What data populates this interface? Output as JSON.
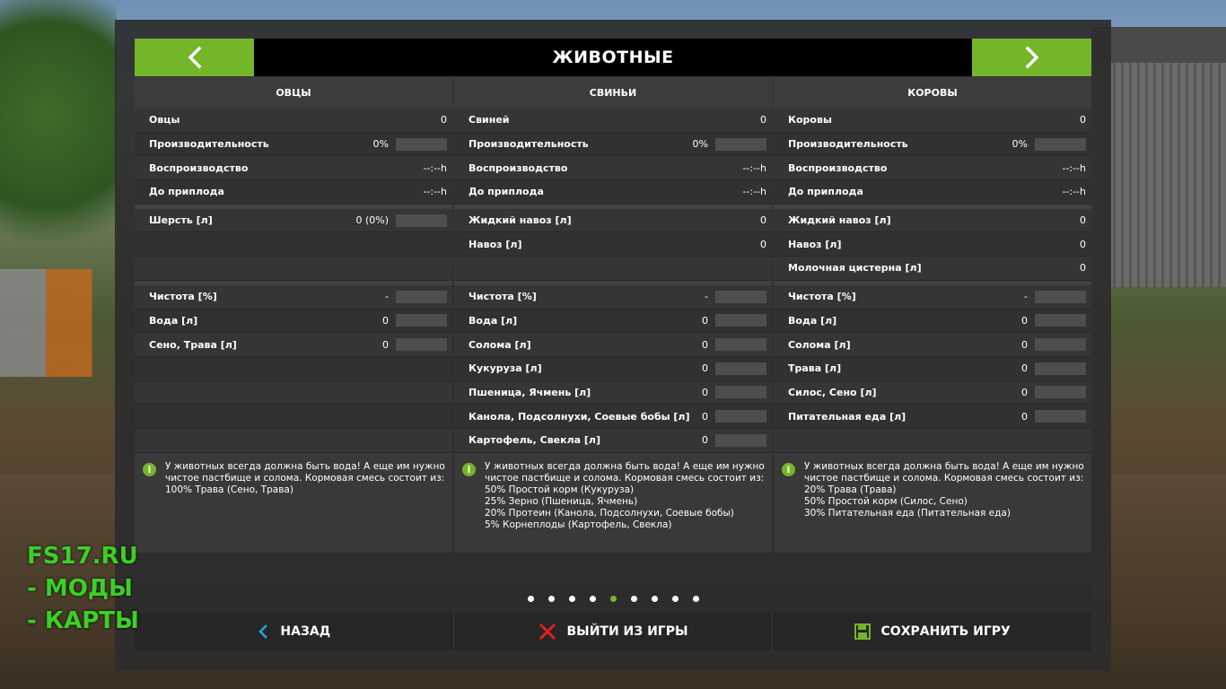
{
  "header": {
    "title": "ЖИВОТНЫЕ"
  },
  "columns": [
    {
      "title": "ОВЦЫ",
      "stats": [
        {
          "label": "Овцы",
          "value": "0",
          "bar": false
        },
        {
          "label": "Производительность",
          "value": "0%",
          "bar": true
        },
        {
          "label": "Воспроизводство",
          "value": "--:--h",
          "bar": false
        },
        {
          "label": "До приплода",
          "value": "--:--h",
          "bar": false
        }
      ],
      "products": [
        {
          "label": "Шерсть [л]",
          "value": "0 (0%)",
          "bar": true
        },
        {
          "label": "",
          "value": "",
          "bar": false
        },
        {
          "label": "",
          "value": "",
          "bar": false
        }
      ],
      "needs": [
        {
          "label": "Чистота [%]",
          "value": "-",
          "bar": true
        },
        {
          "label": "Вода [л]",
          "value": "0",
          "bar": true
        },
        {
          "label": "Сено, Трава [л]",
          "value": "0",
          "bar": true
        },
        {
          "label": "",
          "value": "",
          "bar": false
        },
        {
          "label": "",
          "value": "",
          "bar": false
        },
        {
          "label": "",
          "value": "",
          "bar": false
        },
        {
          "label": "",
          "value": "",
          "bar": false
        }
      ],
      "info": "У животных всегда должна быть вода! А еще им нужно чистое пастбище и солома. Кормовая смесь состоит из:\n100% Трава (Сено, Трава)"
    },
    {
      "title": "СВИНЬИ",
      "stats": [
        {
          "label": "Свиней",
          "value": "0",
          "bar": false
        },
        {
          "label": "Производительность",
          "value": "0%",
          "bar": true
        },
        {
          "label": "Воспроизводство",
          "value": "--:--h",
          "bar": false
        },
        {
          "label": "До приплода",
          "value": "--:--h",
          "bar": false
        }
      ],
      "products": [
        {
          "label": "Жидкий навоз [л]",
          "value": "0",
          "bar": false
        },
        {
          "label": "Навоз [л]",
          "value": "0",
          "bar": false
        },
        {
          "label": "",
          "value": "",
          "bar": false
        }
      ],
      "needs": [
        {
          "label": "Чистота [%]",
          "value": "-",
          "bar": true
        },
        {
          "label": "Вода [л]",
          "value": "0",
          "bar": true
        },
        {
          "label": "Солома [л]",
          "value": "0",
          "bar": true
        },
        {
          "label": "Кукуруза [л]",
          "value": "0",
          "bar": true
        },
        {
          "label": "Пшеница, Ячмень [л]",
          "value": "0",
          "bar": true
        },
        {
          "label": "Канола, Подсолнухи, Соевые бобы [л]",
          "value": "0",
          "bar": true
        },
        {
          "label": "Картофель, Свекла [л]",
          "value": "0",
          "bar": true
        }
      ],
      "info": "У животных всегда должна быть вода! А еще им нужно чистое пастбище и солома. Кормовая смесь состоит из:\n50% Простой корм (Кукуруза)\n25% Зерно (Пшеница, Ячмень)\n20% Протеин (Канола, Подсолнухи, Соевые бобы)\n5% Корнеплоды (Картофель, Свекла)"
    },
    {
      "title": "КОРОВЫ",
      "stats": [
        {
          "label": "Коровы",
          "value": "0",
          "bar": false
        },
        {
          "label": "Производительность",
          "value": "0%",
          "bar": true
        },
        {
          "label": "Воспроизводство",
          "value": "--:--h",
          "bar": false
        },
        {
          "label": "До приплода",
          "value": "--:--h",
          "bar": false
        }
      ],
      "products": [
        {
          "label": "Жидкий навоз [л]",
          "value": "0",
          "bar": false
        },
        {
          "label": "Навоз [л]",
          "value": "0",
          "bar": false
        },
        {
          "label": "Молочная цистерна [л]",
          "value": "0",
          "bar": false
        }
      ],
      "needs": [
        {
          "label": "Чистота [%]",
          "value": "-",
          "bar": true
        },
        {
          "label": "Вода [л]",
          "value": "0",
          "bar": true
        },
        {
          "label": "Солома [л]",
          "value": "0",
          "bar": true
        },
        {
          "label": "Трава [л]",
          "value": "0",
          "bar": true
        },
        {
          "label": "Силос, Сено [л]",
          "value": "0",
          "bar": true
        },
        {
          "label": "Питательная еда [л]",
          "value": "0",
          "bar": true
        },
        {
          "label": "",
          "value": "",
          "bar": false
        }
      ],
      "info": "У животных всегда должна быть вода! А еще им нужно чистое пастбище и солома. Кормовая смесь состоит из:\n20% Трава (Трава)\n50% Простой корм (Силос, Сено)\n30% Питательная еда (Питательная еда)"
    }
  ],
  "pager": {
    "count": 9,
    "active": 4
  },
  "footer": {
    "back_label": "НАЗАД",
    "quit_label": "ВЫЙТИ ИЗ ИГРЫ",
    "save_label": "СОХРАНИТЬ ИГРУ"
  },
  "watermark": {
    "line1": "FS17.RU",
    "line2": "- МОДЫ",
    "line3": "- КАРТЫ"
  },
  "colors": {
    "accent": "#74b52a",
    "watermark": "#3ccf25",
    "quit_icon": "#e02020"
  }
}
